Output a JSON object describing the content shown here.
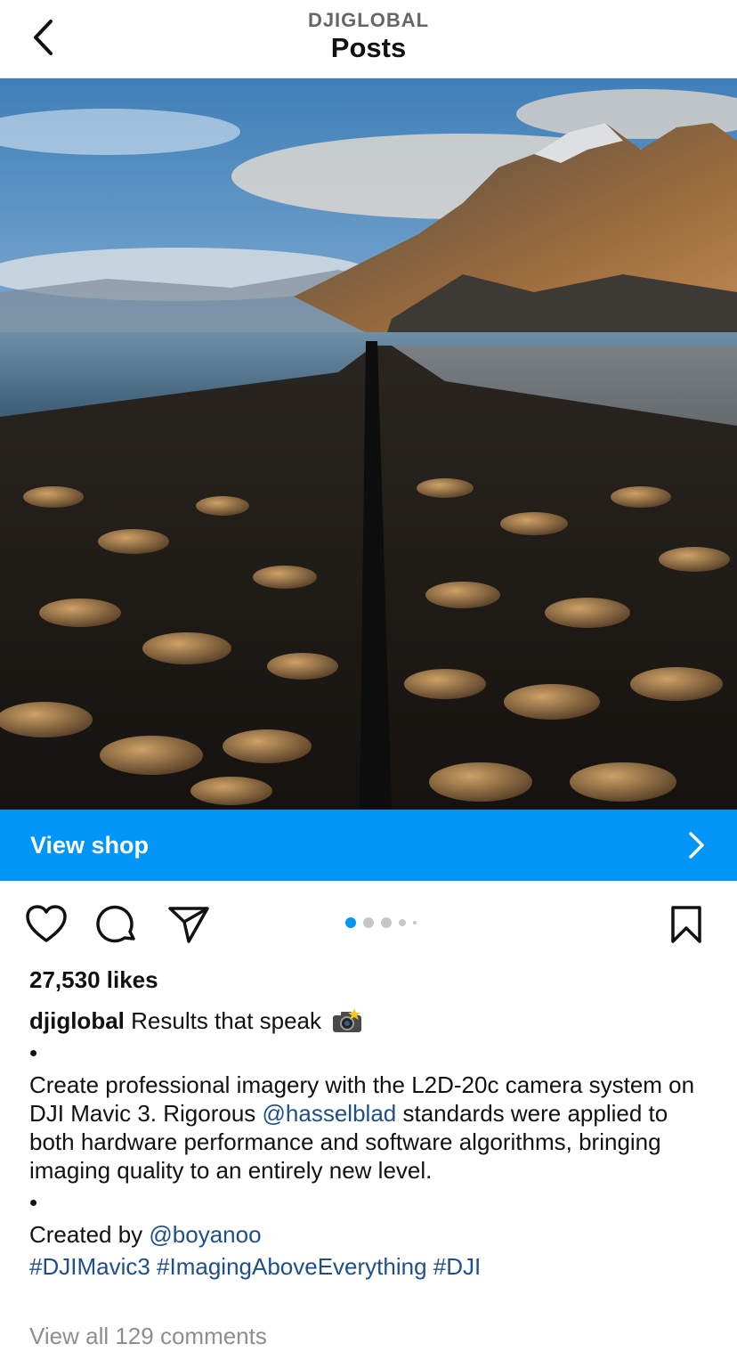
{
  "header": {
    "account": "DJIGLOBAL",
    "title": "Posts"
  },
  "post": {
    "image_alt": "Aerial photo of a long straight road through black sand dunes toward mountains",
    "shop_label": "View shop",
    "carousel": {
      "count": 5,
      "active_index": 0
    },
    "likes": "27,530 likes",
    "caption": {
      "username": "djiglobal",
      "headline": "Results that speak",
      "bullet1": "•",
      "body_before_mention": "Create professional imagery with the L2D-20c camera system on DJI Mavic 3. Rigorous ",
      "mention_brand": "@hasselblad",
      "body_after_mention": " standards were applied to both hardware performance and software algorithms, bringing imaging quality to an entirely new level.",
      "bullet2": "•",
      "credit_prefix": "Created by ",
      "credit_user": "@boyanoo",
      "hashtags": "#DJIMavic3 #ImagingAboveEverything #DJI"
    },
    "comments_link": "View all 129 comments"
  },
  "icons": {
    "back": "chevron-left-icon",
    "shop": "chevron-right-icon",
    "like": "heart-icon",
    "comment": "comment-bubble-icon",
    "share": "paper-plane-icon",
    "save": "bookmark-icon",
    "emoji": "camera-flash-emoji"
  },
  "colors": {
    "accent": "#0095f6",
    "link": "#1f4f8a",
    "muted": "#8e8e8e",
    "dot_active": "#0095f6",
    "dot_inactive": "#c7c7c7"
  }
}
